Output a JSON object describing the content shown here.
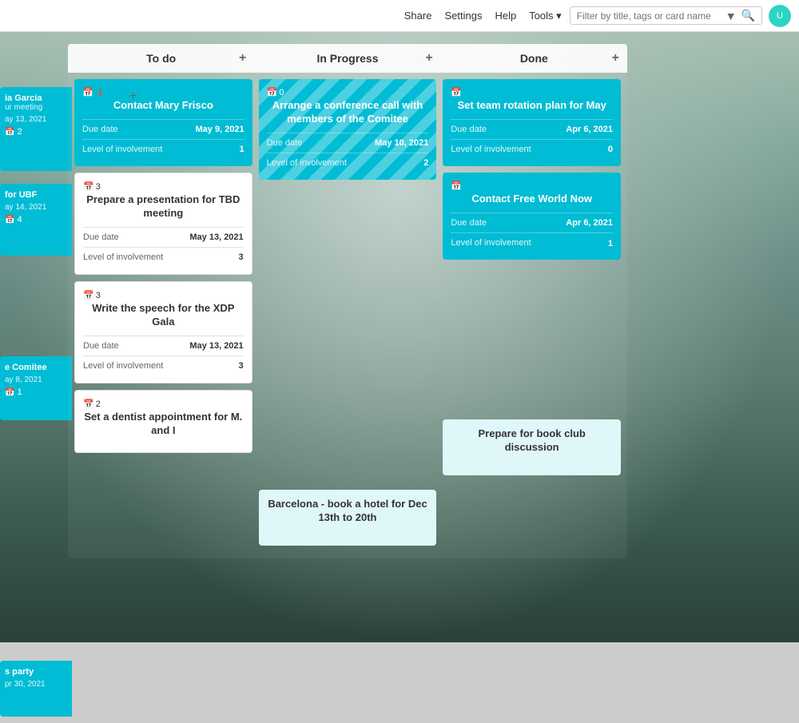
{
  "navbar": {
    "links": [
      "Share",
      "Settings",
      "Help",
      "Tools ▾"
    ],
    "search_placeholder": "Filter by title, tags or card name"
  },
  "board": {
    "columns": [
      {
        "id": "todo",
        "label": "To do"
      },
      {
        "id": "in-progress",
        "label": "In Progress"
      },
      {
        "id": "done",
        "label": "Done"
      }
    ],
    "cards": {
      "todo": [
        {
          "id": "todo-1",
          "calendar_count": "-1",
          "calendar_count_color": "red",
          "title": "Contact Mary Frisco",
          "due_label": "Due date",
          "due_value": "May 9, 2021",
          "level_label": "Level of involvement",
          "level_value": "1",
          "style": "teal"
        },
        {
          "id": "todo-2",
          "calendar_count": "3",
          "calendar_count_color": "white",
          "title": "Prepare a presentation for TBD meeting",
          "due_label": "Due date",
          "due_value": "May 13, 2021",
          "level_label": "Level of involvement",
          "level_value": "3",
          "style": "white"
        },
        {
          "id": "todo-3",
          "calendar_count": "3",
          "calendar_count_color": "white",
          "title": "Write the speech for the XDP Gala",
          "due_label": "Due date",
          "due_value": "May 13, 2021",
          "level_label": "Level of involvement",
          "level_value": "3",
          "style": "white"
        }
      ],
      "todo_bottom": {
        "calendar_count": "2",
        "title": "Set a dentist appointment for M. and I"
      },
      "in_progress": [
        {
          "id": "ip-1",
          "calendar_count": "0",
          "calendar_count_color": "white",
          "title": "Arrange a conference call with members of the Comitee",
          "due_label": "Due date",
          "due_value": "May 10, 2021",
          "level_label": "Level of involvement",
          "level_value": "2",
          "style": "striped"
        }
      ],
      "in_progress_bottom": {
        "title": "Barcelona - book a hotel for Dec 13th to 20th"
      },
      "done": [
        {
          "id": "done-1",
          "calendar_count": "",
          "title": "Set team rotation plan for May",
          "due_label": "Due date",
          "due_value": "Apr 6, 2021",
          "level_label": "Level of involvement",
          "level_value": "0",
          "style": "teal"
        },
        {
          "id": "done-2",
          "calendar_count": "",
          "title": "Contact Free World Now",
          "due_label": "Due date",
          "due_value": "Apr 6, 2021",
          "level_label": "Level of involvement",
          "level_value": "1",
          "style": "teal"
        }
      ],
      "done_bottom": {
        "title": "Prepare for book club discussion"
      }
    },
    "left_partial_cards": [
      {
        "id": "lp-1",
        "title": "ia Garcia",
        "subtitle": "ur meeting",
        "date": "ay 13, 2021",
        "num": "2",
        "style": "teal"
      },
      {
        "id": "lp-2",
        "title": " for UBF",
        "date": "ay 14, 2021",
        "num": "4",
        "style": "teal"
      },
      {
        "id": "lp-3",
        "title": "e Comitee",
        "date": "ay 8, 2021",
        "num": "1",
        "style": "teal"
      },
      {
        "id": "lp-4",
        "title": "s party",
        "date": "pr 30, 2021",
        "style": "teal"
      }
    ]
  }
}
